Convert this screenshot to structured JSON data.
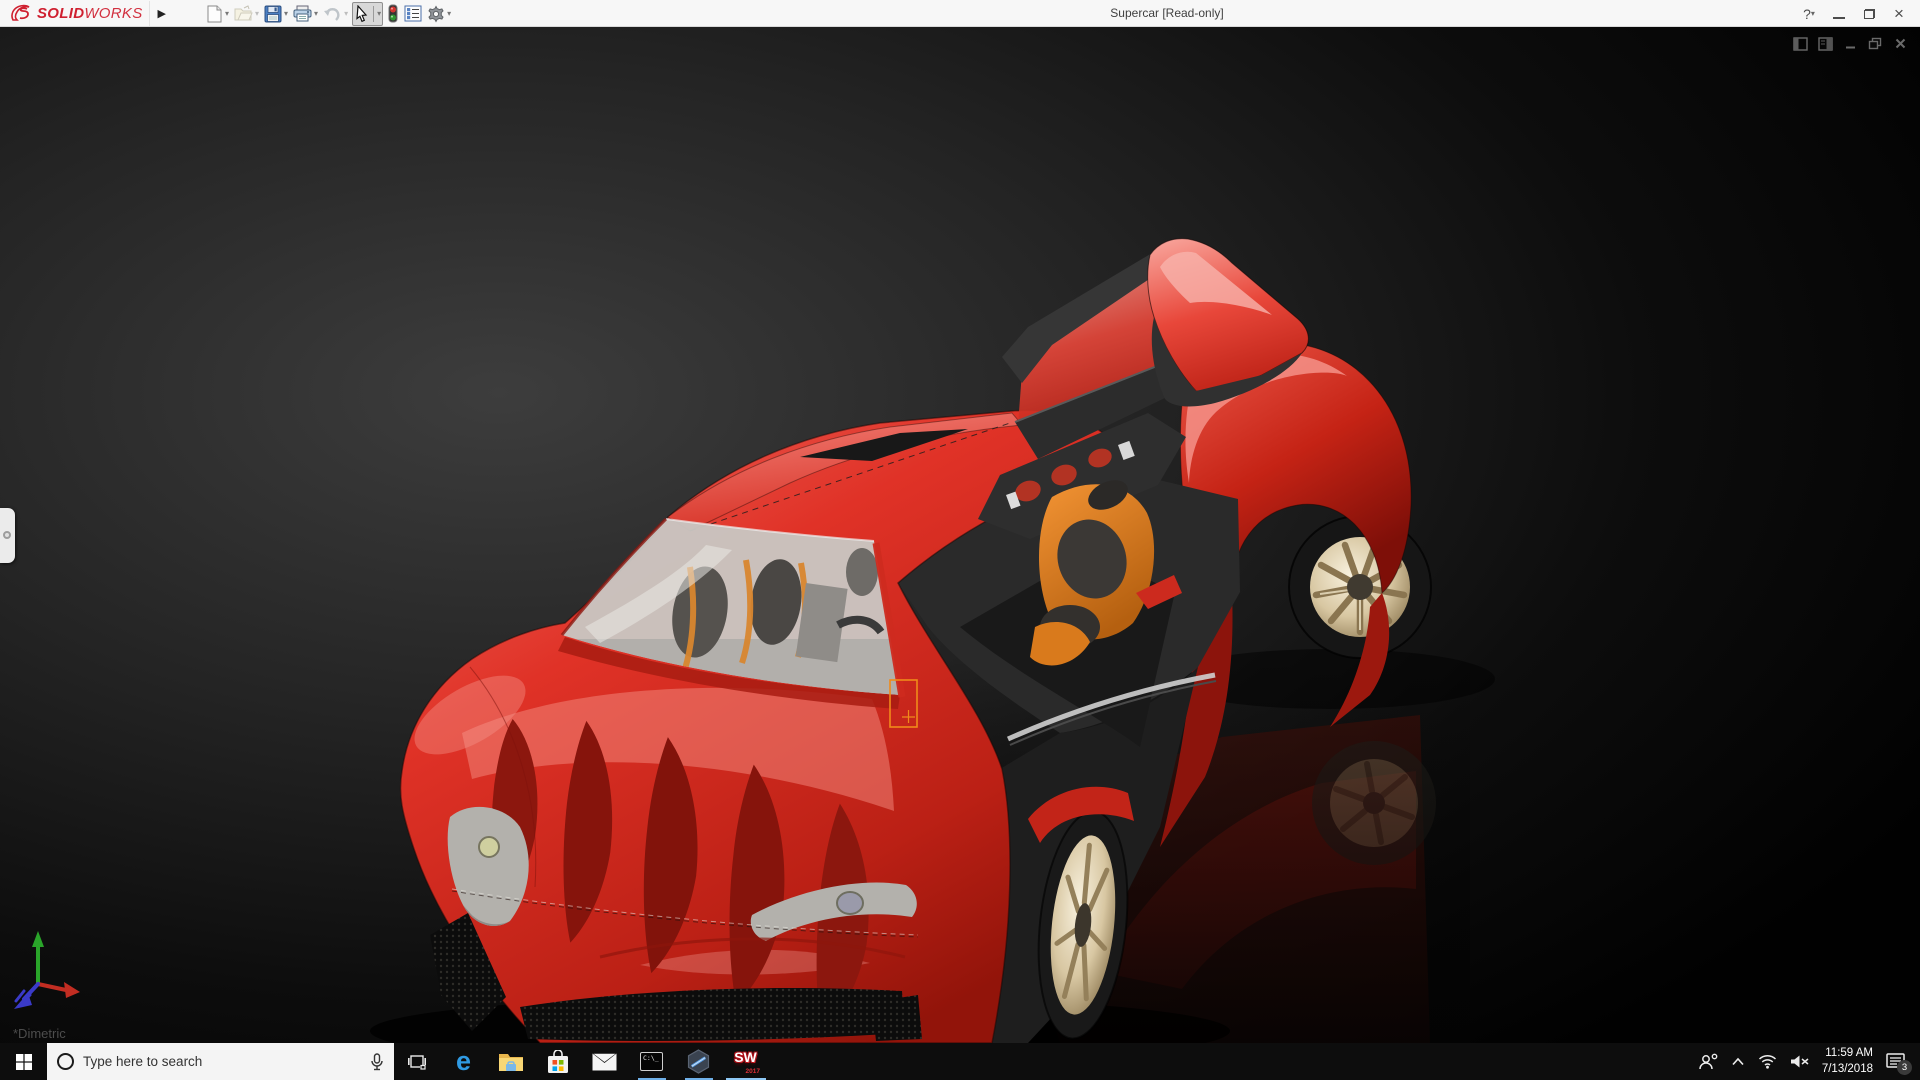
{
  "titlebar": {
    "brand": {
      "solid": "SOLID",
      "works": "WORKS"
    },
    "flyout_arrow": "▶",
    "title": "Supercar [Read-only]",
    "help": "?",
    "tools": [
      {
        "name": "new-document"
      },
      {
        "name": "open-document"
      },
      {
        "name": "save"
      },
      {
        "name": "print"
      },
      {
        "name": "undo"
      },
      {
        "name": "select"
      },
      {
        "name": "rebuild-traffic-light"
      },
      {
        "name": "display-settings-pane"
      },
      {
        "name": "options-gear"
      }
    ]
  },
  "document_window": {
    "controls": [
      "show-feature-pane",
      "show-display-pane",
      "minimize",
      "restore",
      "close"
    ]
  },
  "viewport": {
    "view_orientation_label": "*Dimetric",
    "model_subject": "red supercar with open gullwing door",
    "triad": {
      "x_color": "#c22d22",
      "y_color": "#2aa52a",
      "z_color": "#3a3ac9"
    },
    "selection_color": "#f08a1a",
    "car_body_color": "#e23327"
  },
  "taskbar": {
    "search_placeholder": "Type here to search",
    "command_prompt_glyph": "C:\\_",
    "solidworks_badge": {
      "letters": "SW",
      "year": "2017"
    },
    "apps": [
      {
        "name": "task-view",
        "running": false
      },
      {
        "name": "edge",
        "running": false
      },
      {
        "name": "file-explorer",
        "running": false
      },
      {
        "name": "microsoft-store",
        "running": false
      },
      {
        "name": "mail",
        "running": false
      },
      {
        "name": "command-prompt",
        "running": true
      },
      {
        "name": "cad-viewer",
        "running": true
      },
      {
        "name": "solidworks-2017",
        "running": true,
        "active": true
      }
    ],
    "tray": {
      "time": "11:59 AM",
      "date": "7/13/2018",
      "notification_count": "3"
    }
  }
}
